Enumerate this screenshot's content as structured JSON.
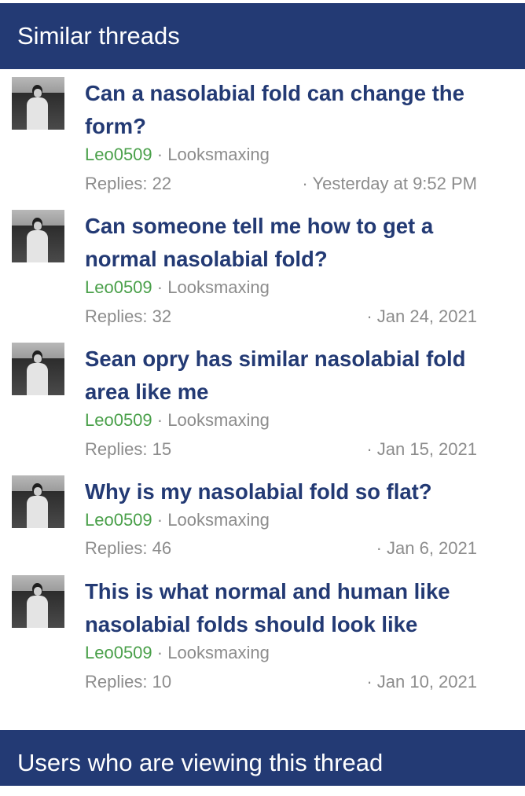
{
  "similar_threads": {
    "heading": "Similar threads",
    "separator": "·",
    "replies_prefix": "Replies: ",
    "threads": [
      {
        "title_line1": "Can a nasolabial fold can change the",
        "title_line2": "form?",
        "author": "Leo0509",
        "forum": "Looksmaxing",
        "replies": "Replies: 22",
        "date": "· Yesterday at 9:52 PM"
      },
      {
        "title_line1": "Can someone tell me how to get a",
        "title_line2": "normal nasolabial fold?",
        "author": "Leo0509",
        "forum": "Looksmaxing",
        "replies": "Replies: 32",
        "date": "· Jan 24, 2021"
      },
      {
        "title_line1": "Sean opry has similar nasolabial fold",
        "title_line2": "area like me",
        "author": "Leo0509",
        "forum": "Looksmaxing",
        "replies": "Replies: 15",
        "date": "· Jan 15, 2021"
      },
      {
        "title_line1": "Why is my nasolabial fold so flat?",
        "title_line2": "",
        "author": "Leo0509",
        "forum": "Looksmaxing",
        "replies": "Replies: 46",
        "date": "· Jan 6, 2021"
      },
      {
        "title_line1": "This is what normal and human like",
        "title_line2": "nasolabial folds should look like",
        "author": "Leo0509",
        "forum": "Looksmaxing",
        "replies": "Replies: 10",
        "date": "· Jan 10, 2021"
      }
    ]
  },
  "viewers": {
    "heading": "Users who are viewing this thread"
  },
  "colors": {
    "header_bg": "#233a74",
    "title": "#233a74",
    "author": "#4aa04a",
    "meta": "#8c8c8c"
  }
}
